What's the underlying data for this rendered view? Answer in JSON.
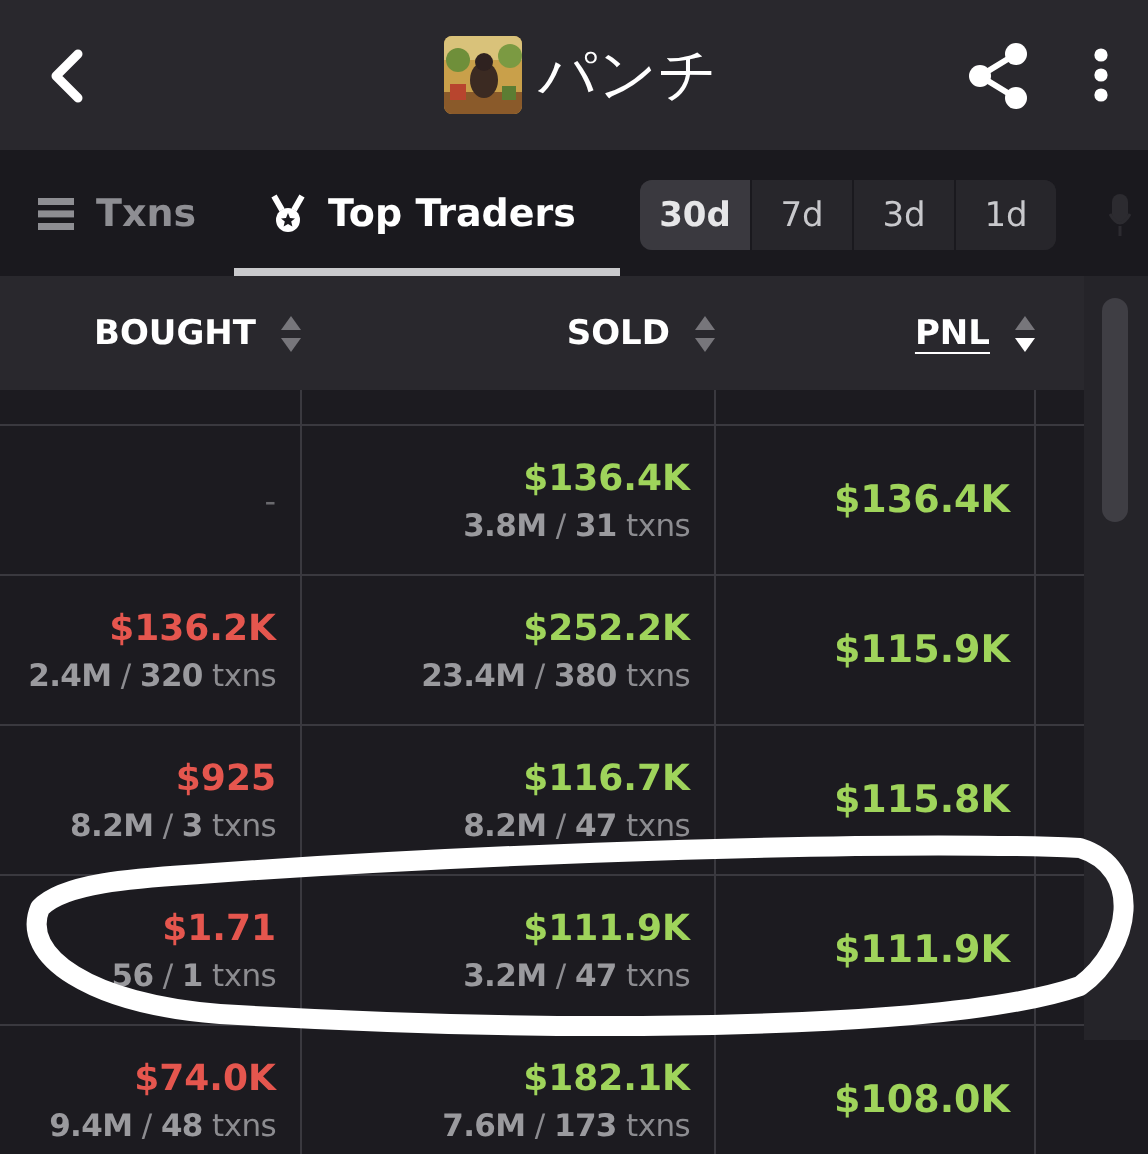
{
  "header": {
    "title": "パンチ"
  },
  "tabs": [
    {
      "label": "Txns",
      "selected": false
    },
    {
      "label": "Top Traders",
      "selected": true
    }
  ],
  "periods": [
    {
      "label": "30d",
      "selected": true
    },
    {
      "label": "7d",
      "selected": false
    },
    {
      "label": "3d",
      "selected": false
    },
    {
      "label": "1d",
      "selected": false
    }
  ],
  "columns": [
    {
      "label": "BOUGHT",
      "sorted": false
    },
    {
      "label": "SOLD",
      "sorted": false
    },
    {
      "label": "PNL",
      "sorted": true
    }
  ],
  "rows": [
    {
      "bought": {
        "kind": "empty",
        "text": "-"
      },
      "sold": {
        "kind": "trade",
        "amount": "$136.4K",
        "sub": "**3.8M** / **31** txns"
      },
      "pnl": "$136.4K"
    },
    {
      "bought": {
        "kind": "trade",
        "amount": "$136.2K",
        "sub": "**2.4M** / **320** txns"
      },
      "sold": {
        "kind": "trade",
        "amount": "$252.2K",
        "sub": "**23.4M** / **380** txns"
      },
      "pnl": "$115.9K"
    },
    {
      "bought": {
        "kind": "trade",
        "amount": "$925",
        "sub": "**8.2M** / **3** txns"
      },
      "sold": {
        "kind": "trade",
        "amount": "$116.7K",
        "sub": "**8.2M** / **47** txns"
      },
      "pnl": "$115.8K"
    },
    {
      "bought": {
        "kind": "trade",
        "amount": "$1.71",
        "sub": "**56** / **1** txns"
      },
      "sold": {
        "kind": "trade",
        "amount": "$111.9K",
        "sub": "**3.2M** / **47** txns"
      },
      "pnl": "$111.9K"
    },
    {
      "bought": {
        "kind": "trade",
        "amount": "$74.0K",
        "sub": "**9.4M** / **48** txns"
      },
      "sold": {
        "kind": "trade",
        "amount": "$182.1K",
        "sub": "**7.6M** / **173** txns"
      },
      "pnl": "$108.0K"
    }
  ]
}
